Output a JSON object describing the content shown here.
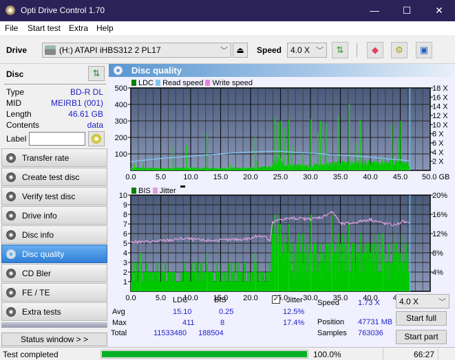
{
  "window": {
    "title": "Opti Drive Control 1.70",
    "minimize": "—",
    "maximize": "☐",
    "close": "✕"
  },
  "menu": [
    "File",
    "Start test",
    "Extra",
    "Help"
  ],
  "toolbar": {
    "drive_label": "Drive",
    "drive_value": "(H:)  ATAPI iHBS312   2 PL17",
    "speed_label": "Speed",
    "speed_value": "4.0 X",
    "icons": [
      "eject-icon",
      "refresh-icon",
      "eraser-icon",
      "settings-icon",
      "save-icon"
    ]
  },
  "disc": {
    "heading": "Disc",
    "fields": [
      {
        "key": "Type",
        "value": "BD-R DL"
      },
      {
        "key": "MID",
        "value": "MEIRB1 (001)"
      },
      {
        "key": "Length",
        "value": "46.61 GB"
      },
      {
        "key": "Contents",
        "value": "data"
      }
    ],
    "label_key": "Label",
    "label_value": ""
  },
  "sidebar": {
    "items": [
      {
        "label": "Transfer rate",
        "active": false
      },
      {
        "label": "Create test disc",
        "active": false
      },
      {
        "label": "Verify test disc",
        "active": false
      },
      {
        "label": "Drive info",
        "active": false
      },
      {
        "label": "Disc info",
        "active": false
      },
      {
        "label": "Disc quality",
        "active": true
      },
      {
        "label": "CD Bler",
        "active": false
      },
      {
        "label": "FE / TE",
        "active": false
      },
      {
        "label": "Extra tests",
        "active": false
      }
    ],
    "status_window": "Status window > >"
  },
  "panel": {
    "title": "Disc quality"
  },
  "chart_data": [
    {
      "type": "bar",
      "title": "",
      "legend": [
        {
          "name": "LDC",
          "color": "#008000"
        },
        {
          "name": "Read speed",
          "color": "#7fc8f0"
        },
        {
          "name": "Write speed",
          "color": "#f080e0"
        }
      ],
      "xlabel": "GB",
      "xlim": [
        0,
        50
      ],
      "x_ticks": [
        "0.0",
        "5.0",
        "10.0",
        "15.0",
        "20.0",
        "25.0",
        "30.0",
        "35.0",
        "40.0",
        "45.0",
        "50.0 GB"
      ],
      "ylim": [
        0,
        500
      ],
      "y_ticks": [
        "500",
        "400",
        "300",
        "200",
        "100"
      ],
      "y2lim": [
        0,
        18
      ],
      "y2_ticks": [
        "18 X",
        "16 X",
        "14 X",
        "12 X",
        "10 X",
        "8 X",
        "6 X",
        "4 X",
        "2 X"
      ],
      "end_marker_gb": 46.61,
      "ldc_baseline": [
        [
          0,
          15
        ],
        [
          5,
          12
        ],
        [
          10,
          14
        ],
        [
          15,
          12
        ],
        [
          20,
          15
        ],
        [
          23.5,
          20
        ],
        [
          24,
          70
        ],
        [
          25,
          60
        ],
        [
          26,
          30
        ],
        [
          30,
          28
        ],
        [
          34,
          40
        ],
        [
          40,
          45
        ],
        [
          44,
          50
        ],
        [
          46.6,
          35
        ]
      ],
      "ldc_spikes": [
        [
          0.5,
          40
        ],
        [
          2,
          50
        ],
        [
          7,
          150
        ],
        [
          9.2,
          150
        ],
        [
          12.7,
          230
        ],
        [
          16.5,
          40
        ],
        [
          20.7,
          200
        ],
        [
          21,
          60
        ],
        [
          24,
          320
        ],
        [
          24.5,
          290
        ],
        [
          25,
          300
        ],
        [
          25.5,
          260
        ],
        [
          26.3,
          310
        ],
        [
          26.8,
          150
        ],
        [
          28.7,
          100
        ],
        [
          30,
          310
        ],
        [
          31.1,
          230
        ],
        [
          31.6,
          300
        ],
        [
          32.5,
          280
        ],
        [
          34.5,
          330
        ],
        [
          36.4,
          405
        ],
        [
          37.5,
          170
        ],
        [
          38.2,
          310
        ],
        [
          43.5,
          280
        ],
        [
          44.5,
          200
        ],
        [
          45,
          300
        ]
      ],
      "read_speed": [
        [
          0,
          1.9
        ],
        [
          2,
          2.2
        ],
        [
          5,
          2.6
        ],
        [
          8,
          2.9
        ],
        [
          10,
          3.1
        ],
        [
          13,
          3.4
        ],
        [
          15,
          3.6
        ],
        [
          18,
          3.9
        ],
        [
          20,
          4.0
        ],
        [
          23,
          4.15
        ],
        [
          25,
          4.15
        ],
        [
          28,
          3.9
        ],
        [
          31,
          3.7
        ],
        [
          34,
          3.4
        ],
        [
          37,
          3.2
        ],
        [
          40,
          2.9
        ],
        [
          43,
          2.5
        ],
        [
          46.6,
          2.1
        ]
      ]
    },
    {
      "type": "bar",
      "title": "",
      "legend": [
        {
          "name": "BIS",
          "color": "#008000"
        },
        {
          "name": "Jitter",
          "color": "#d8a0d8"
        }
      ],
      "xlabel": "GB",
      "xlim": [
        0,
        50
      ],
      "x_ticks": [
        "0.0",
        "5.0",
        "10.0",
        "15.0",
        "20.0",
        "25.0",
        "30.0",
        "35.0",
        "40.0",
        "45.0",
        "50.0 GB"
      ],
      "ylim": [
        0,
        10
      ],
      "y_ticks": [
        "10",
        "9",
        "8",
        "7",
        "6",
        "5",
        "4",
        "3",
        "2",
        "1"
      ],
      "y2lim": [
        0,
        20
      ],
      "y2_ticks": [
        "20%",
        "16%",
        "12%",
        "8%",
        "4%"
      ],
      "end_marker_gb": 46.61,
      "bis_baseline": [
        [
          0,
          2
        ],
        [
          23.3,
          2
        ],
        [
          23.5,
          5
        ],
        [
          25,
          6
        ],
        [
          26,
          4
        ],
        [
          46.6,
          4
        ]
      ],
      "bis_spikes": [
        [
          1.5,
          4
        ],
        [
          12.7,
          4
        ],
        [
          20.7,
          4
        ],
        [
          24,
          8
        ],
        [
          24.5,
          7
        ],
        [
          26.3,
          7
        ],
        [
          30,
          8
        ],
        [
          33.5,
          8
        ],
        [
          36.3,
          7
        ],
        [
          42,
          6
        ]
      ],
      "jitter_pct": [
        [
          0,
          10.2
        ],
        [
          3,
          10.3
        ],
        [
          6,
          10.6
        ],
        [
          9,
          11.0
        ],
        [
          12,
          10.6
        ],
        [
          15,
          10.6
        ],
        [
          18,
          10.8
        ],
        [
          20,
          11.0
        ],
        [
          21.5,
          11.6
        ],
        [
          22.5,
          11.4
        ],
        [
          23.3,
          10.2
        ],
        [
          23.6,
          14.2
        ],
        [
          25,
          15.0
        ],
        [
          27,
          15.2
        ],
        [
          30,
          15.0
        ],
        [
          32,
          15.5
        ],
        [
          33.5,
          16.5
        ],
        [
          34.2,
          15.8
        ],
        [
          35,
          14.0
        ],
        [
          37,
          14.2
        ],
        [
          40,
          15.0
        ],
        [
          42,
          14.2
        ],
        [
          44,
          13.8
        ],
        [
          45.5,
          14.5
        ],
        [
          46.6,
          14.0
        ]
      ]
    }
  ],
  "stats": {
    "col_ldc": "LDC",
    "col_bis": "BIS",
    "jitter_label": "Jitter",
    "jitter_checked": true,
    "rows": [
      {
        "label": "Avg",
        "ldc": "15.10",
        "bis": "0.25",
        "jitter": "12.5%"
      },
      {
        "label": "Max",
        "ldc": "411",
        "bis": "8",
        "jitter": "17.4%"
      },
      {
        "label": "Total",
        "ldc": "11533480",
        "bis": "188504",
        "jitter": ""
      }
    ],
    "speed_label": "Speed",
    "speed_value": "1.73 X",
    "position_label": "Position",
    "position_value": "47731 MB",
    "samples_label": "Samples",
    "samples_value": "763036",
    "speed_select": "4.0 X",
    "start_full": "Start full",
    "start_part": "Start part"
  },
  "statusbar": {
    "text": "Test completed",
    "progress": 1.0,
    "percent": "100.0%",
    "time": "66:27"
  }
}
